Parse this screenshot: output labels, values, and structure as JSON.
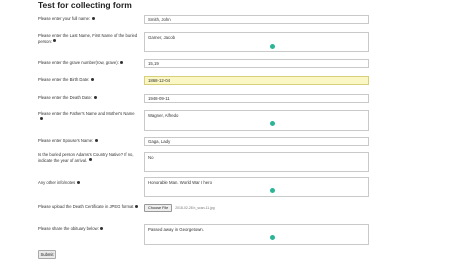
{
  "form": {
    "title": "Test for collecting form",
    "fields": [
      {
        "label": "Please enter your full name:",
        "value": "Smith, John"
      },
      {
        "label": "Please enter the Last Name, First Name of the buried person:",
        "value": "Garner, Jacob"
      },
      {
        "label": "Please enter the grave number(row, grave):",
        "value": "15,19"
      },
      {
        "label": "Please enter the Birth Date:",
        "value": "1868-12-04"
      },
      {
        "label": "Please enter the Death Date:",
        "value": "1948-09-11"
      },
      {
        "label": "Please enter the Father's Name and Mother's Name",
        "value": "Wagner, Alfredo"
      },
      {
        "label": "Please enter Spouse's Name:",
        "value": "Gaga, Lady"
      },
      {
        "label": "Is the buried person Adams's Country Native? If no, indicate the year of arrival.",
        "value": "No"
      },
      {
        "label": "Any other info/notes",
        "value": "Honorable Man. World War I hero"
      },
      {
        "label": "Please upload the Death Certificate in JPEG format",
        "value": "2018-02-28 b_scan-11.jpg"
      },
      {
        "label": "Please share the obituary below:",
        "value": "Passed away in Georgetown."
      }
    ],
    "file_button": "Choose File",
    "submit_label": "Submit"
  },
  "colors": {
    "highlight": "#fbf7c4",
    "assist_dot": "#2bb597"
  }
}
